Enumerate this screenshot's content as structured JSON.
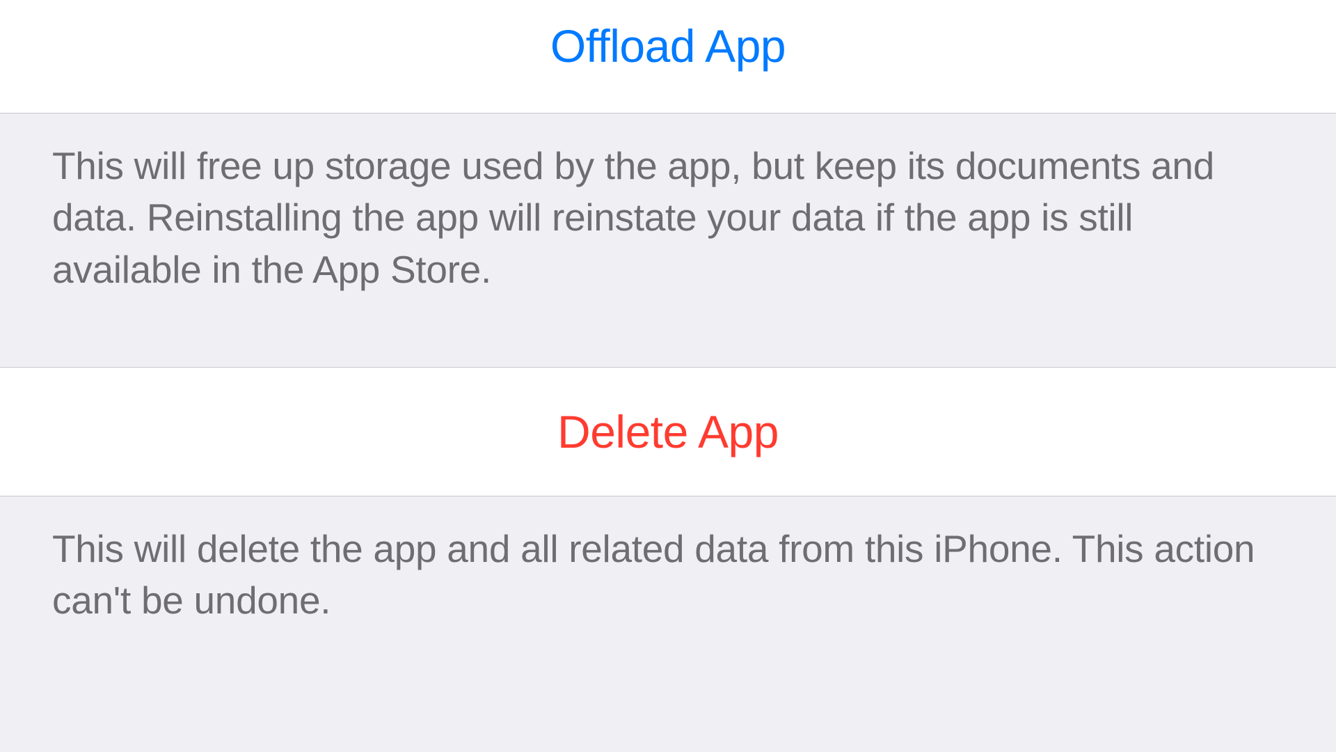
{
  "actions": {
    "offload": {
      "label": "Offload App",
      "description": "This will free up storage used by the app, but keep its documents and data. Reinstalling the app will reinstate your data if the app is still available in the App Store."
    },
    "delete": {
      "label": "Delete App",
      "description": "This will delete the app and all related data from this iPhone. This action can't be undone."
    }
  },
  "colors": {
    "primary": "#007aff",
    "destructive": "#ff3b30",
    "background": "#efeff4",
    "cellBackground": "#ffffff",
    "secondaryText": "#6d6d72",
    "separator": "#c8c7cc"
  }
}
